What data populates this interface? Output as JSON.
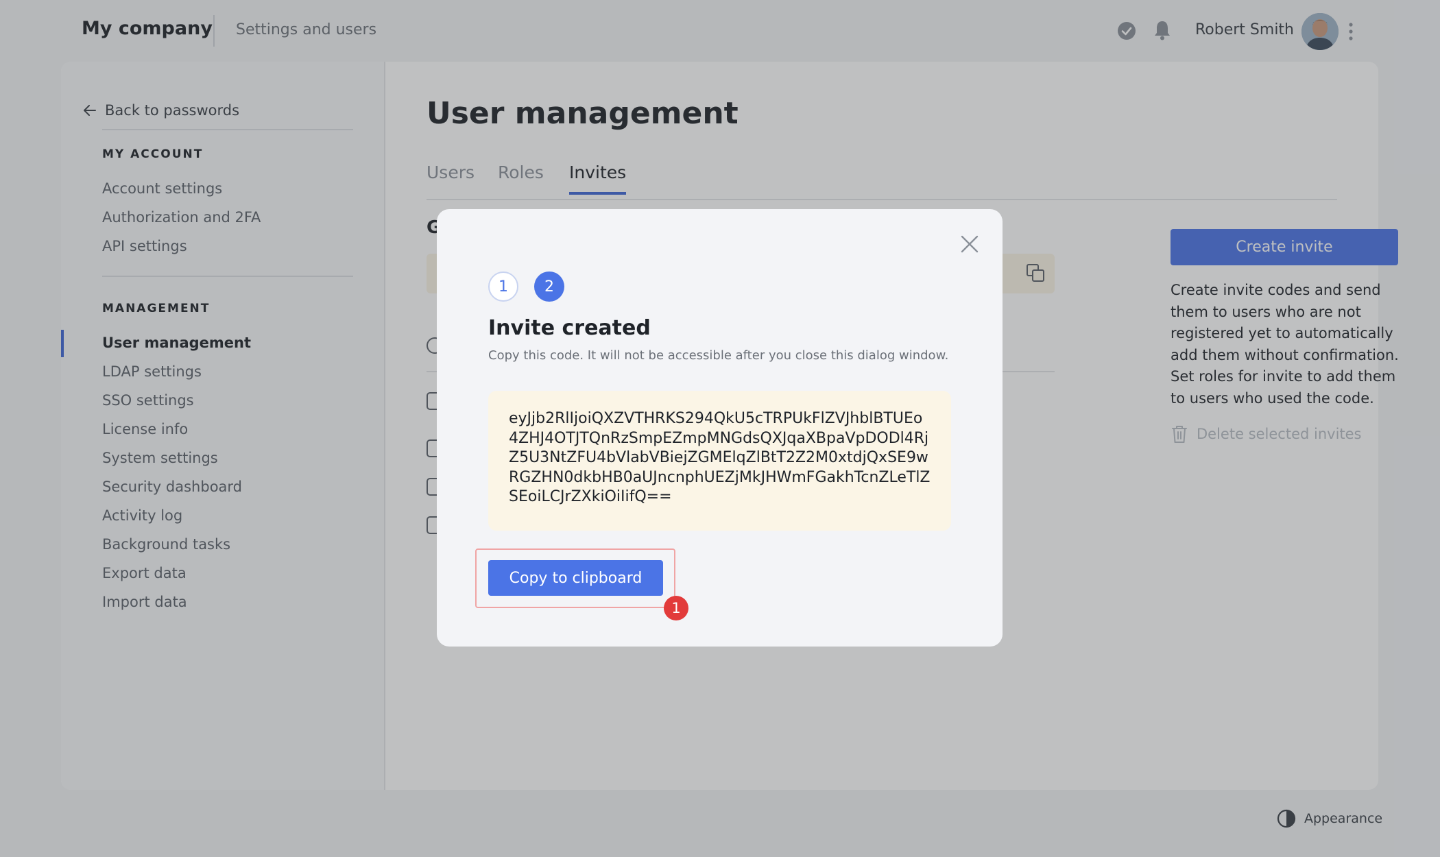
{
  "header": {
    "brand": "My company",
    "section": "Settings and users",
    "user_name": "Robert Smith",
    "icons": [
      "check-circle-icon",
      "bell-icon",
      "avatar",
      "kebab-icon"
    ]
  },
  "sidebar": {
    "back_label": "Back to passwords",
    "my_account": {
      "heading": "MY ACCOUNT",
      "items": [
        "Account settings",
        "Authorization and 2FA",
        "API settings"
      ]
    },
    "management": {
      "heading": "MANAGEMENT",
      "items": [
        "User management",
        "LDAP settings",
        "SSO settings",
        "License info",
        "System settings",
        "Security dashboard",
        "Activity log",
        "Background tasks",
        "Export data",
        "Import data"
      ],
      "active": "User management"
    }
  },
  "main": {
    "title": "User management",
    "tabs": [
      {
        "label": "Users",
        "active": false
      },
      {
        "label": "Roles",
        "active": false
      },
      {
        "label": "Invites",
        "active": true
      }
    ],
    "heading_fragment": "G",
    "create_button": "Create invite",
    "help_text": "Create invite codes and send them to users who are not registered yet to automatically add them without confirmation. Set roles for invite to add them to users who used the code.",
    "delete_label": "Delete selected invites"
  },
  "modal": {
    "steps": [
      "1",
      "2"
    ],
    "current_step": 2,
    "title": "Invite created",
    "subtitle": "Copy this code. It will not be accessible after you close this dialog window.",
    "code": "eyJjb2RlIjoiQXZVTHRKS294QkU5cTRPUkFlZVJhblBTUEo4ZHJ4OTJTQnRzSmpEZmpMNGdsQXJqaXBpaVpDODl4RjZ5U3NtZFU4bVlabVBiejZGMElqZlBtT2Z2M0xtdjQxSE9wRGZHN0dkbHB0aUJncnphUEZjMkJHWmFGakhTcnZLeTlZSEoiLCJrZXkiOiIifQ==",
    "copy_button": "Copy to clipboard",
    "marker": "1"
  },
  "footer": {
    "appearance": "Appearance"
  },
  "colors": {
    "accent": "#4b74e6",
    "code_bg": "#fbf5e6",
    "marker": "#e23b3b"
  }
}
